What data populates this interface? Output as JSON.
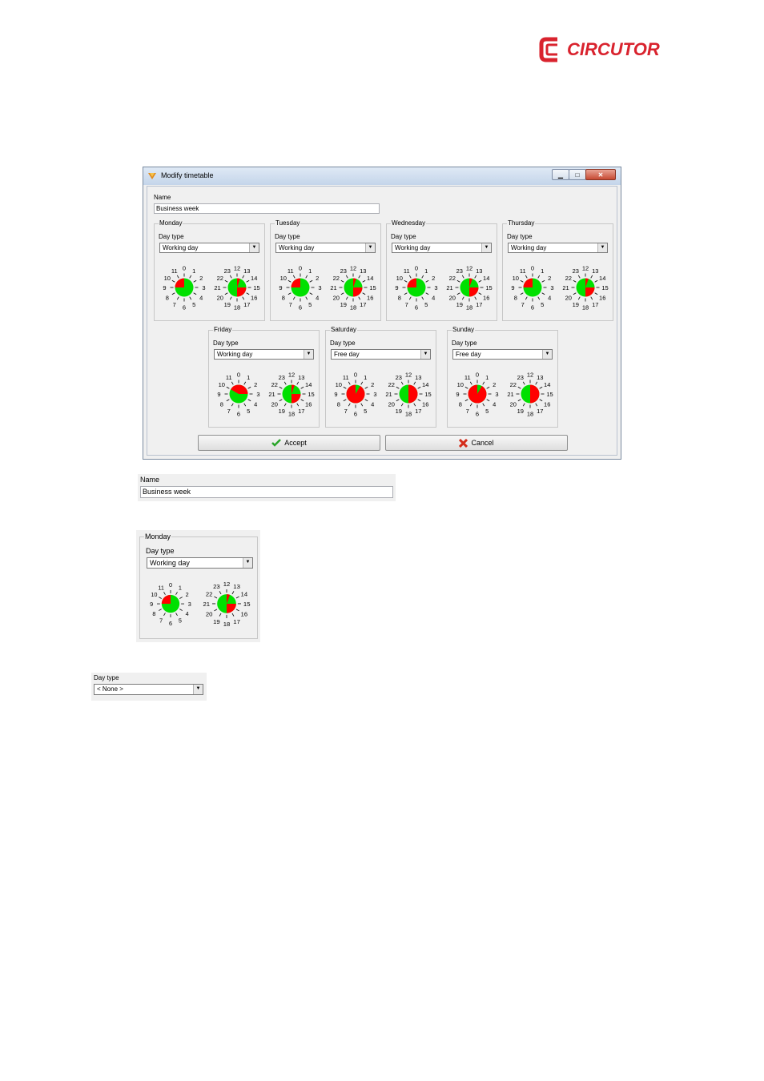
{
  "brand": {
    "name": "CIRCUTOR",
    "color": "#d9232e"
  },
  "window": {
    "title": "Modify timetable",
    "icon": "timetable-app-icon",
    "controls": {
      "minimize": "minimize-icon",
      "maximize": "maximize-icon",
      "close": "close-icon"
    },
    "name_label": "Name",
    "name_value": "Business week",
    "day_type_label": "Day type",
    "days": [
      {
        "name": "Monday",
        "day_type": "Working day"
      },
      {
        "name": "Tuesday",
        "day_type": "Working day"
      },
      {
        "name": "Wednesday",
        "day_type": "Working day"
      },
      {
        "name": "Thursday",
        "day_type": "Working day"
      },
      {
        "name": "Friday",
        "day_type": "Working day"
      },
      {
        "name": "Saturday",
        "day_type": "Free day"
      },
      {
        "name": "Sunday",
        "day_type": "Free day"
      }
    ],
    "clock_numbers_am": [
      "0",
      "1",
      "2",
      "3",
      "4",
      "5",
      "6",
      "7",
      "8",
      "9",
      "10",
      "11"
    ],
    "clock_numbers_pm": [
      "12",
      "13",
      "14",
      "15",
      "16",
      "17",
      "18",
      "19",
      "20",
      "21",
      "22",
      "23"
    ],
    "accept_label": "Accept",
    "cancel_label": "Cancel"
  },
  "detail_name": {
    "label": "Name",
    "value": "Business week"
  },
  "detail_group": {
    "name": "Monday",
    "day_type_label": "Day type",
    "day_type": "Working day"
  },
  "detail_daytype": {
    "label": "Day type",
    "value": "< None >"
  },
  "colors": {
    "active": "#ff0000",
    "inactive": "#00e000"
  }
}
